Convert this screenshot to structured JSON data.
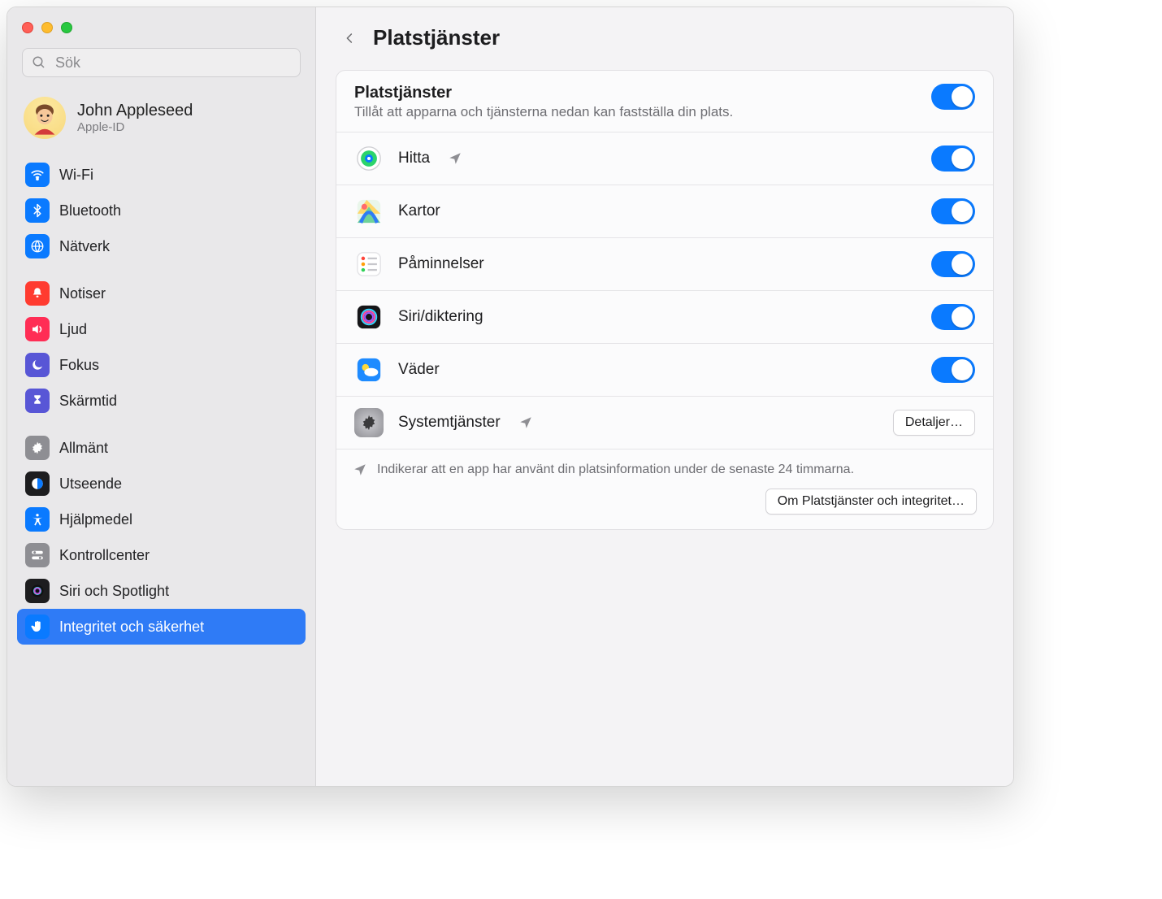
{
  "search": {
    "placeholder": "Sök"
  },
  "account": {
    "name": "John Appleseed",
    "sub": "Apple-ID"
  },
  "sidebar": {
    "group1": [
      {
        "label": "Wi-Fi",
        "icon": "wifi",
        "bg": "#0a7aff"
      },
      {
        "label": "Bluetooth",
        "icon": "bluetooth",
        "bg": "#0a7aff"
      },
      {
        "label": "Nätverk",
        "icon": "globe",
        "bg": "#0a7aff"
      }
    ],
    "group2": [
      {
        "label": "Notiser",
        "icon": "bell",
        "bg": "#ff3b30"
      },
      {
        "label": "Ljud",
        "icon": "sound",
        "bg": "#ff2d55"
      },
      {
        "label": "Fokus",
        "icon": "moon",
        "bg": "#5856d6"
      },
      {
        "label": "Skärmtid",
        "icon": "hourglass",
        "bg": "#5856d6"
      }
    ],
    "group3": [
      {
        "label": "Allmänt",
        "icon": "gear",
        "bg": "#8e8e93"
      },
      {
        "label": "Utseende",
        "icon": "appearance",
        "bg": "#1d1d1f"
      },
      {
        "label": "Hjälpmedel",
        "icon": "accessibility",
        "bg": "#0a7aff"
      },
      {
        "label": "Kontrollcenter",
        "icon": "switches",
        "bg": "#8e8e93"
      },
      {
        "label": "Siri och Spotlight",
        "icon": "siri",
        "bg": "#1d1d1f"
      },
      {
        "label": "Integritet och säkerhet",
        "icon": "hand",
        "bg": "#0a7aff",
        "selected": true
      }
    ]
  },
  "page": {
    "title": "Platstjänster",
    "master": {
      "title": "Platstjänster",
      "desc": "Tillåt att apparna och tjänsterna nedan kan fastställa din plats."
    },
    "apps": [
      {
        "name": "Hitta",
        "icon": "findmy",
        "recent": true,
        "toggle": true
      },
      {
        "name": "Kartor",
        "icon": "maps",
        "recent": false,
        "toggle": true
      },
      {
        "name": "Påminnelser",
        "icon": "reminders",
        "recent": false,
        "toggle": true
      },
      {
        "name": "Siri/diktering",
        "icon": "siri-round",
        "recent": false,
        "toggle": true
      },
      {
        "name": "Väder",
        "icon": "weather",
        "recent": false,
        "toggle": true
      }
    ],
    "system": {
      "name": "Systemtjänster",
      "button": "Detaljer…"
    },
    "footer": {
      "note": "Indikerar att en app har använt din platsinformation under de senaste 24 timmarna.",
      "about": "Om Platstjänster och integritet…"
    }
  }
}
